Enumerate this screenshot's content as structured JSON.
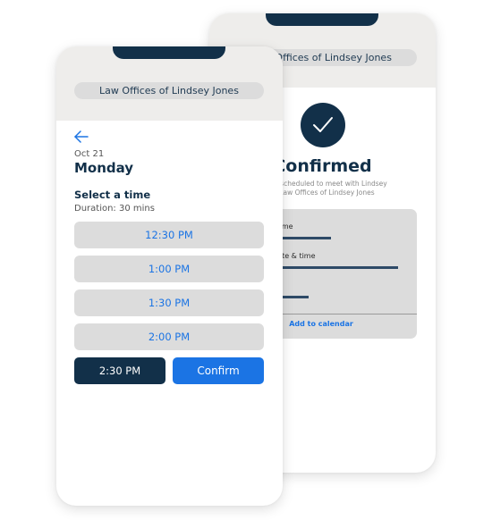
{
  "back_phone": {
    "org_name": "Law Offices of Lindsey Jones",
    "status_icon": "checkmark-icon",
    "title": "Confirmed",
    "subtitle_line1": "You're scheduled to meet with Lindsey",
    "subtitle_line2": "at Law Offices of Lindsey Jones",
    "details": [
      {
        "label": "Name"
      },
      {
        "label": "Date & time"
      },
      {
        "label": ""
      }
    ],
    "add_to_calendar_label": "Add to calendar"
  },
  "front_phone": {
    "org_name": "Law Offices of Lindsey Jones",
    "back_icon": "arrow-left-icon",
    "date": "Oct 21",
    "day": "Monday",
    "select_title": "Select a time",
    "duration": "Duration: 30 mins",
    "time_slots": [
      "12:30 PM",
      "1:00 PM",
      "1:30 PM",
      "2:00 PM"
    ],
    "selected_slot": "2:30 PM",
    "confirm_label": "Confirm"
  },
  "colors": {
    "navy": "#123049",
    "accent_blue": "#1b74e4",
    "header_bg": "#eeedeb",
    "slot_bg": "#dcdcdc"
  }
}
